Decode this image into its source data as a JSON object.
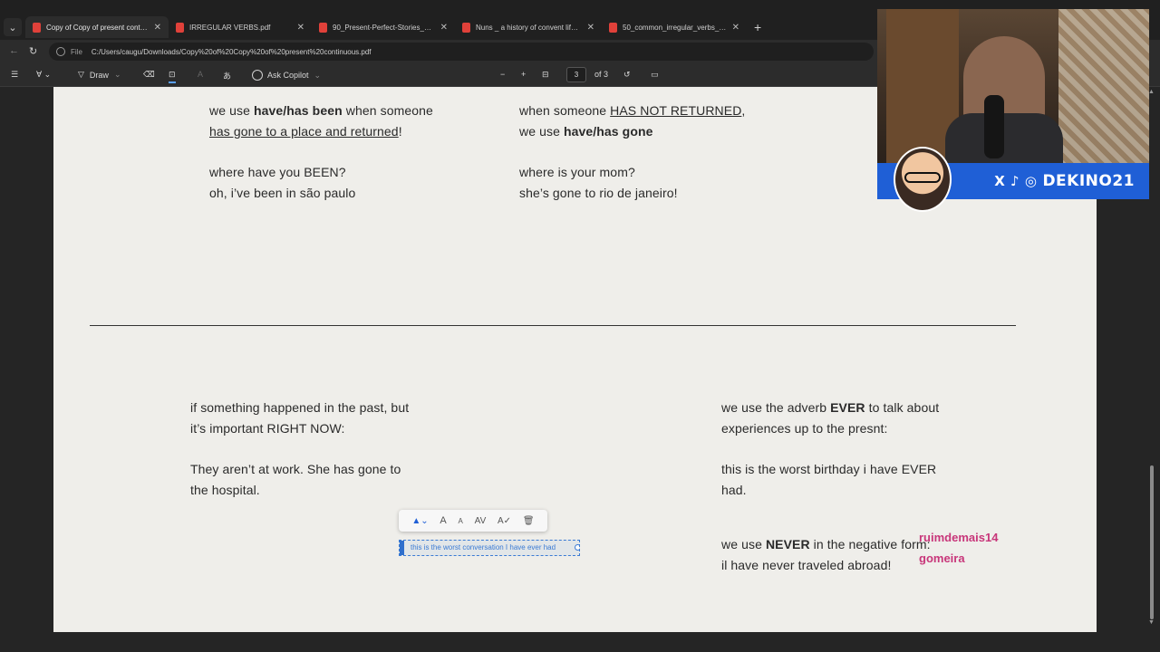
{
  "browser": {
    "tabs": [
      {
        "label": "Copy of Copy of present continuo",
        "active": true
      },
      {
        "label": "IRREGULAR VERBS.pdf",
        "active": false
      },
      {
        "label": "90_Present-Perfect-Stories_US_St",
        "active": false
      },
      {
        "label": "Nuns _ a history of convent life, 14",
        "active": false
      },
      {
        "label": "50_common_irregular_verbs_list.p",
        "active": false
      }
    ],
    "new_tab": "+",
    "address": {
      "file_label": "File",
      "url": "C:/Users/caugu/Downloads/Copy%20of%20Copy%20of%20present%20continuous.pdf"
    }
  },
  "pdf_toolbar": {
    "draw_label": "Draw",
    "ask_copilot_label": "Ask Copilot",
    "zoom_out": "−",
    "zoom_in": "+",
    "page_current": "3",
    "page_total": "of 3"
  },
  "document": {
    "top_left": {
      "l1_a": "we use ",
      "l1_b": "have/has been",
      "l1_c": " when someone",
      "l2_a": "has gone to a place and returned",
      "l2_b": "!",
      "l3": "where have you BEEN?",
      "l4": "oh, i’ve been in são paulo"
    },
    "top_right": {
      "l1_a": "when someone ",
      "l1_b": "HAS NOT RETURNED",
      "l1_c": ",",
      "l2_a": "we use ",
      "l2_b": "have/has gone",
      "l3": "where is your mom?",
      "l4": "she’s gone to rio de janeiro!"
    },
    "bottom_left": {
      "l1": "if something happened in the past, but",
      "l2": "it’s important RIGHT NOW:",
      "l3": "They aren’t at work. She has gone to",
      "l4": "the hospital."
    },
    "bottom_right": {
      "l1_a": "we use the adverb ",
      "l1_b": "EVER",
      "l1_c": " to talk about",
      "l2": "experiences up to the presnt:",
      "l3": "this is the worst birthday i have EVER",
      "l4": "had.",
      "l5_a": "we use ",
      "l5_b": "NEVER",
      "l5_c": " in the negative form:",
      "l6": "il have never traveled abroad!"
    },
    "annotation_text": "this is the worst conversation I have ever had"
  },
  "annotation_toolbar": {
    "color_icon": "text-color-icon",
    "increase": "A",
    "decrease": "A",
    "spacing": "AV",
    "spell": "A✓",
    "delete": "🗑"
  },
  "stream_overlay": {
    "social_handle": "DEKINO21",
    "social_icons": "X ♪ ◎",
    "brand_color": "#1f5fd6"
  },
  "chat": [
    {
      "text": "ruimdemais14",
      "color": "#c8367a"
    },
    {
      "text": "gomeira",
      "color": "#c8367a"
    }
  ]
}
